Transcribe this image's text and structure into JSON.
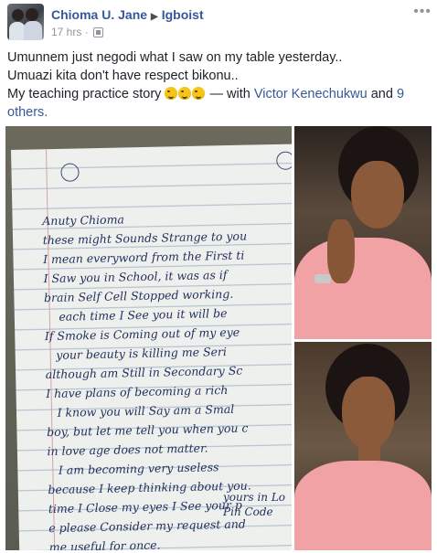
{
  "post": {
    "author": "Chioma U. Jane",
    "group": "Igboist",
    "time": "17 hrs",
    "more_icon": "more-dots-icon",
    "lines": [
      "Umunnem just negodi what I saw on my table yesterday..",
      "Umuazi kita don't have respect bikonu..",
      "My teaching practice story"
    ],
    "tagged_prefix": " — with ",
    "tagged_person": "Victor Kenechukwu",
    "and_text": " and ",
    "others_link": "9",
    "others_tail": "others."
  },
  "letter": {
    "lines": [
      "Anuty Chioma",
      "these might Sounds Strange to you",
      "I mean everyword from the First ti",
      "I Saw you in School, it was as if",
      "brain Self Cell Stopped working.",
      "    each time I See you it will be",
      "If Smoke is Coming out of my eye",
      "   your beauty is killing me Seri",
      "although am Still in Secondary Sc",
      "I have plans of becoming a rich",
      "   I know you will Say am a Smal",
      "boy, but let me tell you when you c",
      "in love age does not matter.",
      "   I am becoming very useless",
      "because I keep thinking about you.",
      "time I Close my eyes I See your p",
      "e please Consider my request and",
      "me useful for once."
    ],
    "sign": [
      "yours in Lo",
      "Pin Code"
    ]
  },
  "colors": {
    "link": "#365899",
    "meta": "#90949c",
    "ink": "#22305e",
    "shirt": "#f1a2a5"
  }
}
